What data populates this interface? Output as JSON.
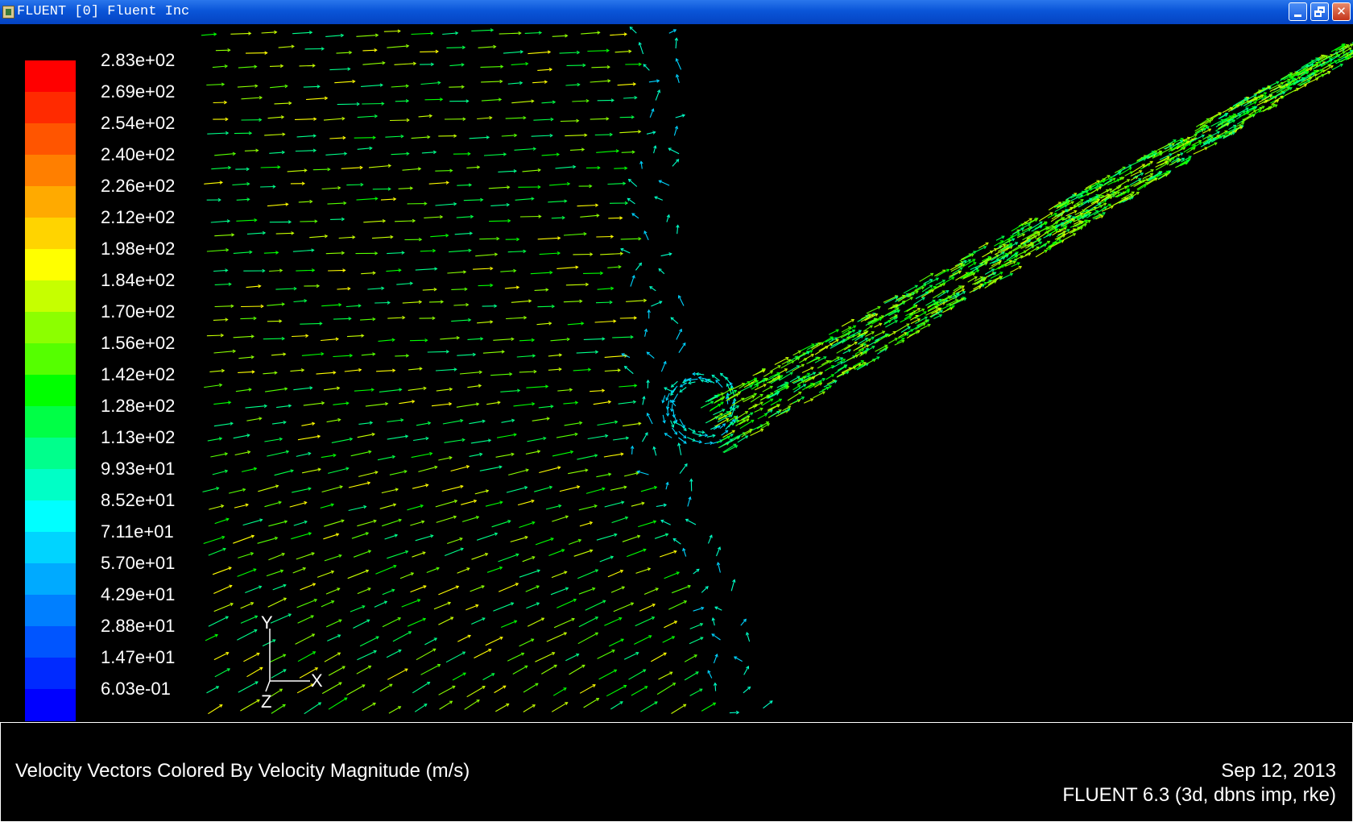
{
  "window": {
    "title": "FLUENT [0] Fluent Inc",
    "minimize_label": "",
    "maximize_label": "",
    "close_label": "✕"
  },
  "legend": {
    "labels": [
      "2.83e+02",
      "2.69e+02",
      "2.54e+02",
      "2.40e+02",
      "2.26e+02",
      "2.12e+02",
      "1.98e+02",
      "1.84e+02",
      "1.70e+02",
      "1.56e+02",
      "1.42e+02",
      "1.28e+02",
      "1.13e+02",
      "9.93e+01",
      "8.52e+01",
      "7.11e+01",
      "5.70e+01",
      "4.29e+01",
      "2.88e+01",
      "1.47e+01",
      "6.03e-01"
    ],
    "colors": [
      "#ff0000",
      "#ff2a00",
      "#ff5500",
      "#ff7f00",
      "#ffaa00",
      "#ffd400",
      "#ffff00",
      "#c6ff00",
      "#8cff00",
      "#55ff00",
      "#00ff00",
      "#00ff46",
      "#00ff8c",
      "#00ffc6",
      "#00ffff",
      "#00d4ff",
      "#00aaff",
      "#007fff",
      "#0055ff",
      "#002aff",
      "#0000ff"
    ]
  },
  "axes": {
    "x": "X",
    "y": "Y",
    "z": "Z"
  },
  "info": {
    "title": "Velocity Vectors Colored By Velocity Magnitude (m/s)",
    "date": "Sep 12, 2013",
    "version": "FLUENT 6.3 (3d, dbns imp, rke)"
  }
}
